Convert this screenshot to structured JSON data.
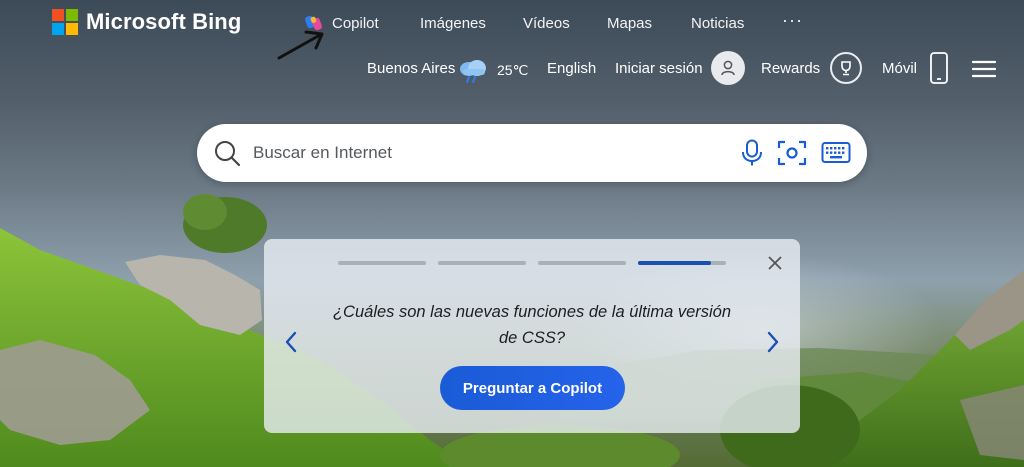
{
  "brand": {
    "name": "Microsoft Bing"
  },
  "nav": {
    "copilot": "Copilot",
    "images": "Imágenes",
    "videos": "Vídeos",
    "maps": "Mapas",
    "news": "Noticias",
    "more": "···"
  },
  "header": {
    "location": "Buenos Aires",
    "temperature": "25℃",
    "language": "English",
    "signin": "Iniciar sesión",
    "rewards": "Rewards",
    "mobile": "Móvil"
  },
  "search": {
    "placeholder": "Buscar en Internet"
  },
  "card": {
    "question": "¿Cuáles son las nuevas funciones de la última versión de CSS?",
    "button": "Preguntar a Copilot",
    "progress": {
      "segments": 4,
      "active_index": 3,
      "active_fill_percent": 83
    }
  },
  "colors": {
    "accent": "#1a5bd6",
    "progress_active": "#1a4fb3",
    "logo": [
      "#f25022",
      "#7fba00",
      "#00a4ef",
      "#ffb900"
    ]
  },
  "icons": {
    "weather": "cloud-rain-icon",
    "signin": "user-icon",
    "rewards": "trophy-icon",
    "mobile": "phone-icon",
    "menu": "hamburger-icon",
    "search": "search-icon",
    "voice": "microphone-icon",
    "visual": "camera-search-icon",
    "keyboard": "keyboard-icon"
  }
}
